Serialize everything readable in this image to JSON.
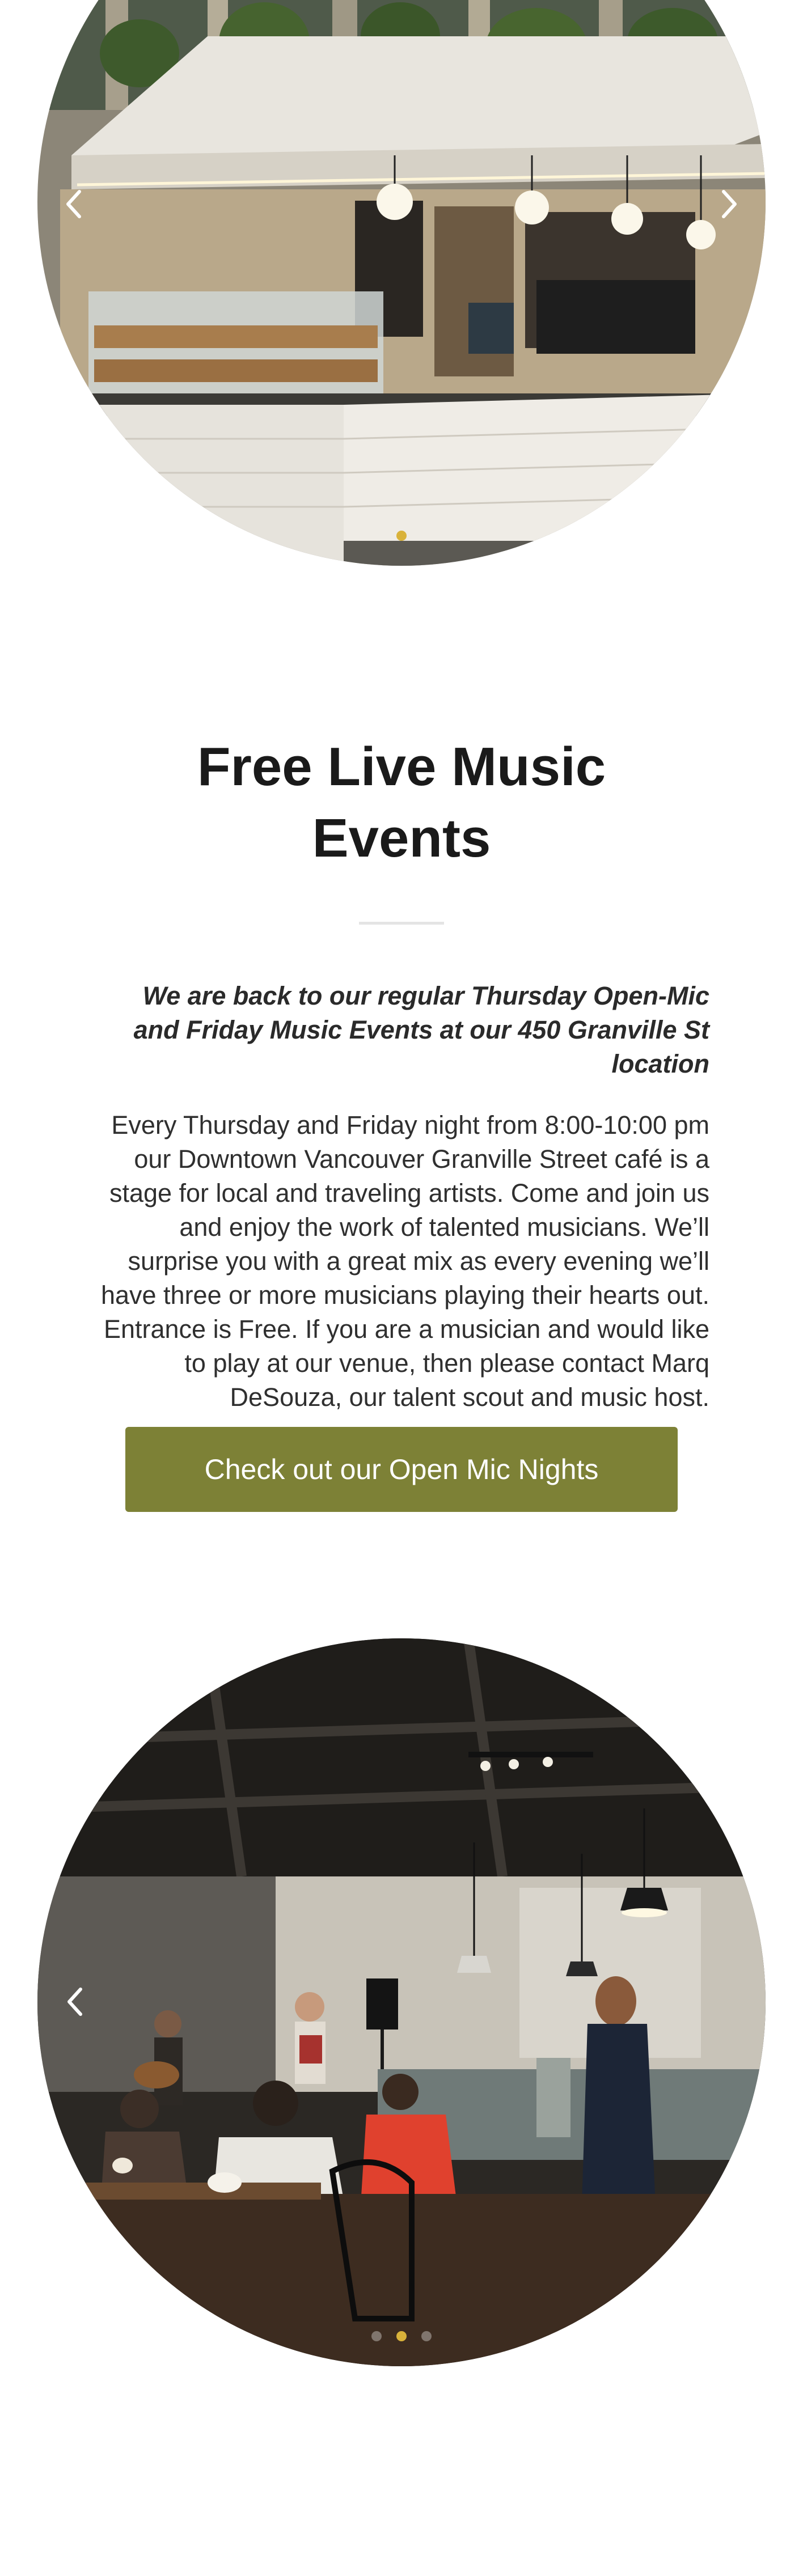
{
  "sliders": {
    "top": {
      "prev_icon": "chevron-left-icon",
      "next_icon": "chevron-right-icon",
      "slide_count": 3,
      "active_index": 0
    },
    "bottom": {
      "prev_icon": "chevron-left-icon",
      "slide_count": 3,
      "active_index": 1
    }
  },
  "events": {
    "title": "Free Live Music Events",
    "lead": "We are back to our regular Thursday Open-Mic and Friday Music Events at our 450 Granville St location",
    "body": "Every Thursday and Friday night from 8:00-10:00 pm our Downtown Vancouver Granville Street café is a stage for local and traveling artists. Come and join us and enjoy the work of talented musicians. We’ll surprise you with a great mix as every evening we’ll have three or more musicians playing their hearts out. Entrance is Free. If you are a musician and would like to play at our venue, then please contact Marq DeSouza, our talent scout and music host.",
    "cta_label": "Check out our Open Mic Nights"
  },
  "colors": {
    "cta_background": "#7d8136",
    "cta_text": "#ffffff",
    "active_dot": "#d9b23a",
    "divider": "#e4e4e4"
  }
}
